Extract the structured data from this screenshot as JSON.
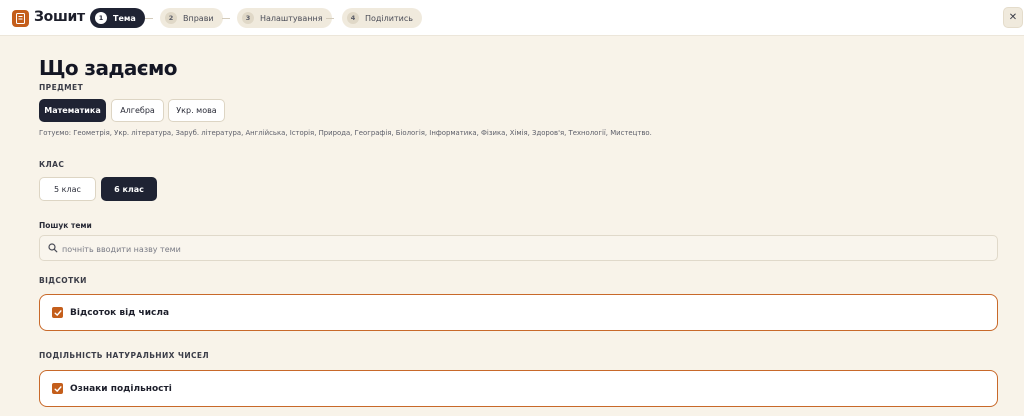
{
  "app": {
    "title": "Зошит"
  },
  "steps": [
    {
      "num": "1",
      "label": "Тема",
      "active": true
    },
    {
      "num": "2",
      "label": "Вправи",
      "active": false
    },
    {
      "num": "3",
      "label": "Налаштування",
      "active": false
    },
    {
      "num": "4",
      "label": "Поділитись",
      "active": false
    }
  ],
  "header": {
    "close_label": "✕"
  },
  "main": {
    "title": "Що задаємо",
    "subject": {
      "label": "ПРЕДМЕТ",
      "options": [
        "Математика",
        "Алгебра",
        "Укр. мова"
      ],
      "selected": "Математика",
      "coming_soon": "Готуємо: Геометрія, Укр. література, Заруб. література, Англійська, Історія, Природа, Географія, Біологія, Інформатика, Фізика, Хімія, Здоров'я, Технології, Мистецтво."
    },
    "grade": {
      "label": "КЛАС",
      "options": [
        "5 клас",
        "6 клас"
      ],
      "selected": "6 клас"
    },
    "search": {
      "label": "Пошук теми",
      "placeholder": "почніть вводити назву теми",
      "value": ""
    },
    "sections": [
      {
        "title": "ВІДСОТКИ",
        "topics": [
          {
            "name": "Відсоток від числа",
            "checked": true
          }
        ]
      },
      {
        "title": "ПОДІЛЬНІСТЬ НАТУРАЛЬНИХ ЧИСЕЛ",
        "topics": [
          {
            "name": "Ознаки подільності",
            "checked": true
          }
        ]
      }
    ]
  },
  "colors": {
    "accent": "#c45e1b",
    "dark": "#1f2333",
    "background": "#f8f3e9"
  }
}
